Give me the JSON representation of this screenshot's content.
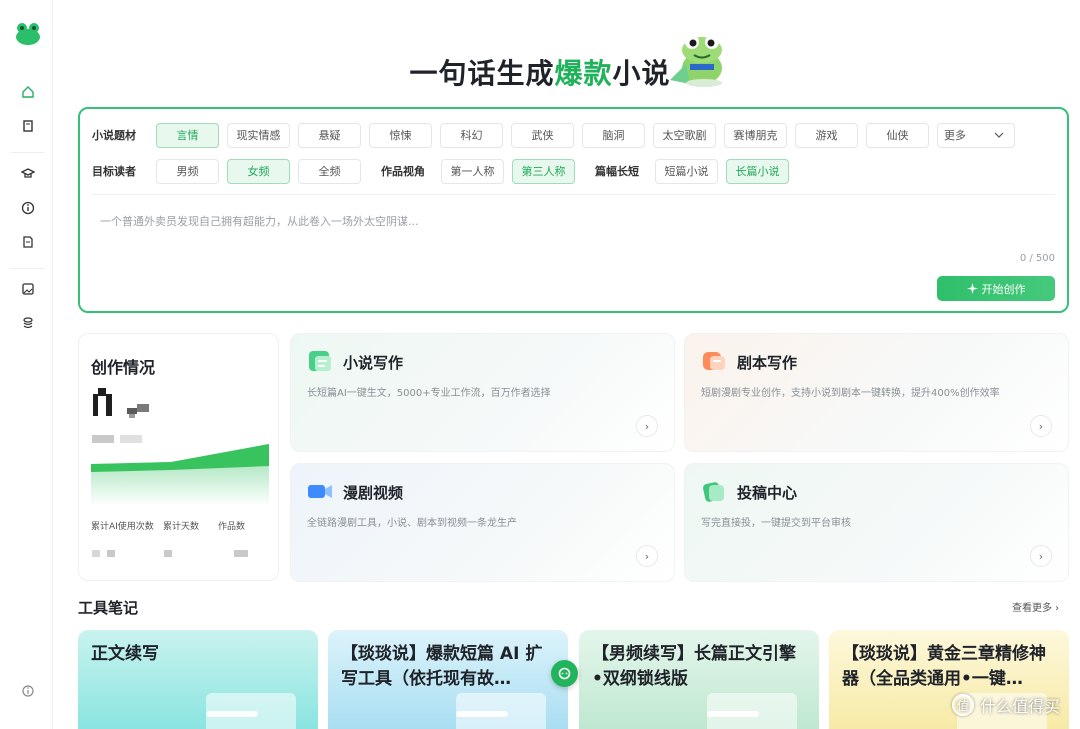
{
  "hero": {
    "title_a": "一句话生成",
    "title_highlight": "爆款",
    "title_b": "小说"
  },
  "rail": {
    "items": [
      "home-icon",
      "book-icon",
      "graduation-cap-icon",
      "info-icon",
      "document-icon",
      "image-edit-icon",
      "coin-stack-icon",
      "info-circle-icon"
    ]
  },
  "prompt": {
    "genre_label": "小说题材",
    "genres": [
      "言情",
      "现实情感",
      "悬疑",
      "惊悚",
      "科幻",
      "武侠",
      "脑洞",
      "太空歌剧",
      "赛博朋克",
      "游戏",
      "仙侠"
    ],
    "genre_selected": "言情",
    "more_label": "更多",
    "reader_label": "目标读者",
    "readers": [
      "男频",
      "女频",
      "全频"
    ],
    "reader_selected": "女频",
    "pov_label": "作品视角",
    "povs": [
      "第一人称",
      "第三人称"
    ],
    "pov_selected": "第三人称",
    "length_label": "篇幅长短",
    "lengths": [
      "短篇小说",
      "长篇小说"
    ],
    "length_selected": "长篇小说",
    "placeholder": "一个普通外卖员发现自己拥有超能力，从此卷入一场外太空阴谋...",
    "counter": "0 / 500",
    "start_label": "开始创作"
  },
  "stats": {
    "title": "创作情况",
    "labels": [
      "累计AI使用次数",
      "累计天数",
      "作品数"
    ]
  },
  "features": [
    {
      "title": "小说写作",
      "desc": "长短篇AI一键生文，5000+专业工作流，百万作者选择",
      "icon": "novel-icon"
    },
    {
      "title": "剧本写作",
      "desc": "短剧漫剧专业创作，支持小说到剧本一键转换，提升400%创作效率",
      "icon": "script-icon"
    },
    {
      "title": "漫剧视频",
      "desc": "全链路漫剧工具，小说、剧本到视频一条龙生产",
      "icon": "video-icon"
    },
    {
      "title": "投稿中心",
      "desc": "写完直接投，一键提交到平台审核",
      "icon": "submit-icon"
    }
  ],
  "tools": {
    "title": "工具笔记",
    "see_more": "查看更多",
    "notes": [
      {
        "title": "正文续写",
        "color": "#9fe6e3"
      },
      {
        "title": "【琰琰说】爆款短篇 AI 扩写工具（依托现有故…",
        "color": "#bfe8f6"
      },
      {
        "title": "【男频续写】长篇正文引擎•双纲锁线版",
        "color": "#cdeedd"
      },
      {
        "title": "【琰琰说】黄金三章精修神器（全品类通用•一键…",
        "color": "#fbf3c4"
      }
    ]
  },
  "watermark": {
    "text": "什么值得买",
    "logo": "值"
  },
  "colors": {
    "accent": "#20b25a",
    "accent_light": "#e9f8ef"
  }
}
